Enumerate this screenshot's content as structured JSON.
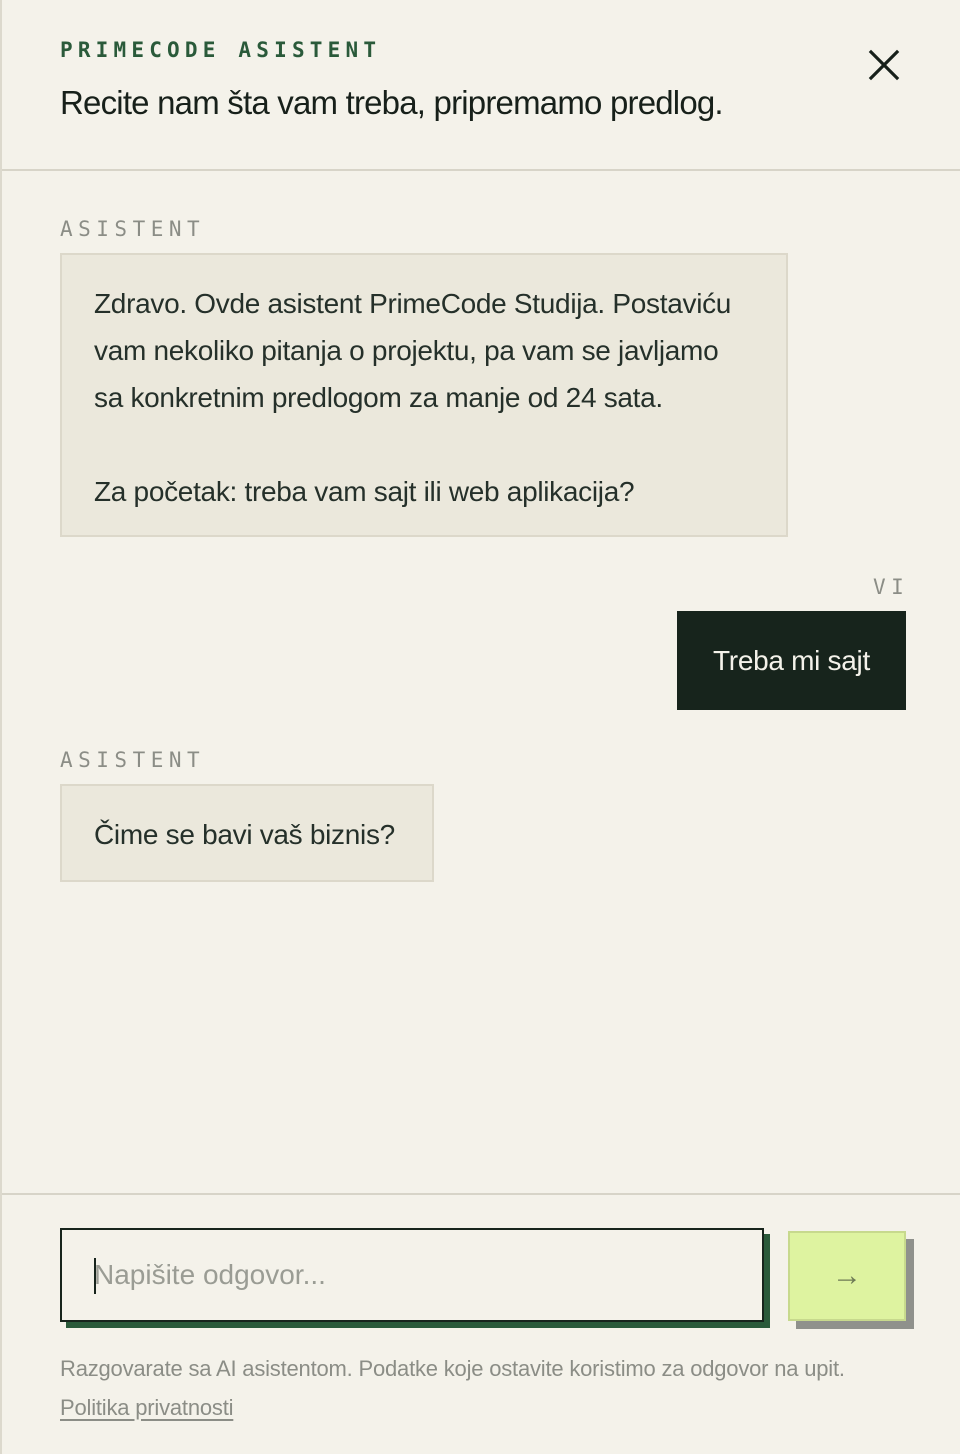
{
  "header": {
    "brand": "PRIMECODE ASISTENT",
    "title": "Recite nam šta vam treba, pripremamo predlog.",
    "close_icon": "close-icon"
  },
  "messages": [
    {
      "role_label": "ASISTENT",
      "text": "Zdravo. Ovde asistent PrimeCode Studija. Postaviću vam nekoliko pitanja o projektu, pa vam se javljamo sa konkretnim predlogom za manje od 24 sata.\n\nZa početak: treba vam sajt ili web aplikacija?"
    },
    {
      "role_label": "VI",
      "text": "Treba mi sajt"
    },
    {
      "role_label": "ASISTENT",
      "text": "Čime se bavi vaš biznis?"
    }
  ],
  "composer": {
    "value": "",
    "placeholder": "Napišite odgovor...",
    "send_icon": "arrow-right-icon",
    "send_glyph": "→"
  },
  "footer": {
    "disclaimer": "Razgovarate sa AI asistentom. Podatke koje ostavite koristimo za odgovor na upit.",
    "privacy_link": "Politika privatnosti"
  },
  "colors": {
    "background": "#f4f2ea",
    "brand_green": "#2a5a3a",
    "user_bubble": "#17241c",
    "bot_bubble": "#ebe8dc",
    "send_button": "#def3a0"
  }
}
